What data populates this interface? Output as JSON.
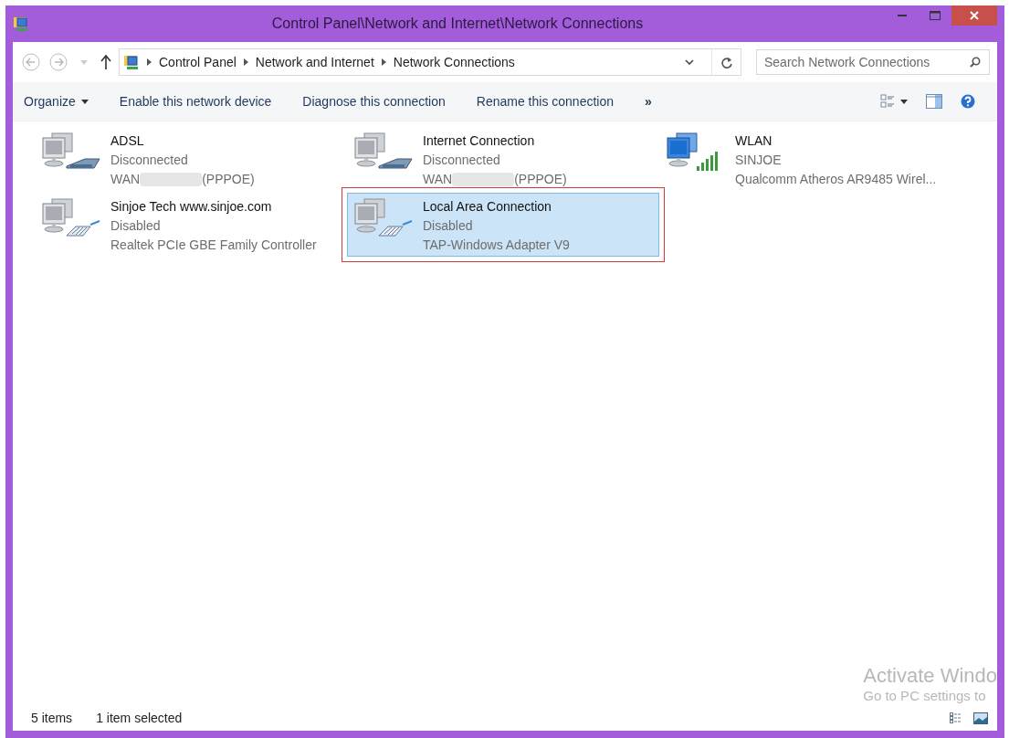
{
  "window": {
    "title": "Control Panel\\Network and Internet\\Network Connections"
  },
  "address_bar": {
    "crumbs": [
      "Control Panel",
      "Network and Internet",
      "Network Connections"
    ]
  },
  "search": {
    "placeholder": "Search Network Connections"
  },
  "command_bar": {
    "items": [
      {
        "label": "Organize",
        "kind": "menu"
      },
      {
        "label": "Enable this network device",
        "kind": "command"
      },
      {
        "label": "Diagnose this connection",
        "kind": "command"
      },
      {
        "label": "Rename this connection",
        "kind": "command"
      },
      {
        "label": "»",
        "kind": "overflow"
      }
    ]
  },
  "connections": [
    {
      "name": "ADSL",
      "status": "Disconnected",
      "device_parts": [
        "WAN",
        "(PPPOE)"
      ],
      "kind": "modem",
      "selected": false,
      "outlined": false
    },
    {
      "name": "Internet Connection",
      "status": "Disconnected",
      "device_parts": [
        "WAN",
        "(PPPOE)"
      ],
      "kind": "modem",
      "selected": false,
      "outlined": false
    },
    {
      "name": "WLAN",
      "status": "SINJOE",
      "device_parts": [
        "Qualcomm Atheros AR9485 Wirel..."
      ],
      "kind": "wireless",
      "selected": false,
      "outlined": false
    },
    {
      "name": "Sinjoe Tech www.sinjoe.com",
      "status": "Disabled",
      "device_parts": [
        "Realtek PCIe GBE Family Controller"
      ],
      "kind": "ethernet",
      "selected": false,
      "outlined": false
    },
    {
      "name": "Local Area Connection",
      "status": "Disabled",
      "device_parts": [
        "TAP-Windows Adapter V9"
      ],
      "kind": "ethernet",
      "selected": true,
      "outlined": true
    }
  ],
  "activation_notice": [
    "Activate Windo",
    "Go to PC settings to"
  ],
  "status_bar": [
    "5 items",
    "1 item selected"
  ]
}
